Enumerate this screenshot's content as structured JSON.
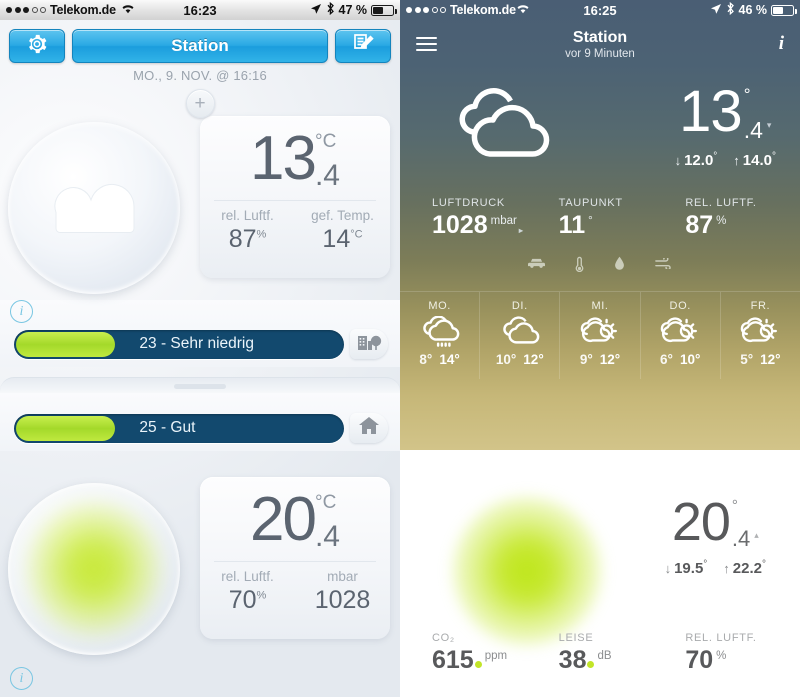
{
  "left": {
    "status": {
      "carrier": "Telekom.de",
      "time": "16:23",
      "battery": "47 %"
    },
    "toolbar": {
      "settings_icon": "gear-icon",
      "title": "Station",
      "edit_icon": "edit-note-icon"
    },
    "date": "MO., 9. NOV. @ 16:16",
    "add_label": "+",
    "outdoor": {
      "weather_icon": "cloud-icon",
      "temp": "13",
      "unit": "°C",
      "decimal": ".4",
      "metrics": [
        {
          "label": "rel. Luftf.",
          "value": "87",
          "unit": "%"
        },
        {
          "label": "gef. Temp.",
          "value": "14",
          "unit": "°C"
        }
      ],
      "info_icon": "info-icon",
      "bar": {
        "text": "23 - Sehr niedrig",
        "fill_percent": 30,
        "icon": "building-tree-icon"
      }
    },
    "indoor": {
      "temp": "20",
      "unit": "°C",
      "decimal": ".4",
      "metrics": [
        {
          "label": "rel. Luftf.",
          "value": "70",
          "unit": "%"
        },
        {
          "label": "mbar",
          "value": "1028",
          "unit": ""
        }
      ],
      "info_icon": "info-icon",
      "bar": {
        "text": "25 - Gut",
        "fill_percent": 30,
        "icon": "home-icon"
      }
    }
  },
  "right": {
    "status": {
      "carrier": "Telekom.de",
      "time": "16:25",
      "battery": "46 %"
    },
    "nav": {
      "menu_icon": "hamburger-icon",
      "title": "Station",
      "subtitle": "vor 9 Minuten",
      "info_icon": "info-icon"
    },
    "outdoor": {
      "weather_icon": "double-cloud-icon",
      "temp": "13",
      "degree": "°",
      "decimal": ".4",
      "trend": "▾",
      "min": "12.0",
      "min_deg": "°",
      "max": "14.0",
      "max_deg": "°",
      "metrics": [
        {
          "label": "LUFTDRUCK",
          "value": "1028",
          "unit": "mbar",
          "trend": "▸"
        },
        {
          "label": "TAUPUNKT",
          "value": "11",
          "unit": "°",
          "trend": ""
        },
        {
          "label": "REL. LUFTF.",
          "value": "87",
          "unit": "%",
          "trend": ""
        }
      ]
    },
    "condition_icons": [
      "car-icon",
      "thermometer-icon",
      "droplet-icon",
      "wind-icon"
    ],
    "forecast": [
      {
        "day": "MO.",
        "icon": "cloud-rain-icon",
        "low": "8°",
        "high": "14°"
      },
      {
        "day": "DI.",
        "icon": "double-cloud-icon",
        "low": "10°",
        "high": "12°"
      },
      {
        "day": "MI.",
        "icon": "sun-cloud-icon",
        "low": "9°",
        "high": "12°"
      },
      {
        "day": "DO.",
        "icon": "sun-cloud-icon",
        "low": "6°",
        "high": "10°"
      },
      {
        "day": "FR.",
        "icon": "sun-cloud-icon",
        "low": "5°",
        "high": "12°"
      }
    ],
    "indoor": {
      "temp": "20",
      "degree": "°",
      "decimal": ".4",
      "trend": "▴",
      "min": "19.5",
      "min_deg": "°",
      "max": "22.2",
      "max_deg": "°",
      "metrics": [
        {
          "label": "CO₂",
          "value": "615",
          "unit": "ppm",
          "dot": true
        },
        {
          "label": "LEISE",
          "value": "38",
          "unit": "dB",
          "dot": true
        },
        {
          "label": "REL. LUFTF.",
          "value": "70",
          "unit": "%",
          "dot": false
        }
      ]
    }
  }
}
